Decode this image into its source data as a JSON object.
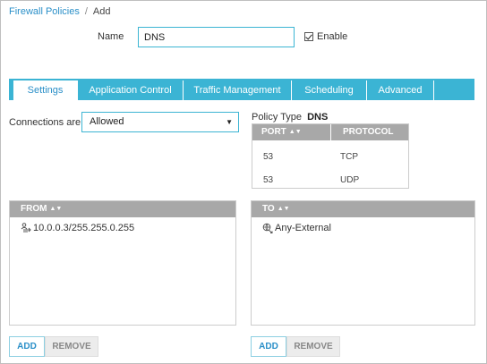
{
  "breadcrumb": {
    "parent": "Firewall Policies",
    "separator": "/",
    "current": "Add"
  },
  "form": {
    "name_label": "Name",
    "name_value": "DNS",
    "enable_label": "Enable",
    "enable_checked": true
  },
  "tabs": [
    {
      "label": "Settings",
      "active": true
    },
    {
      "label": "Application Control",
      "active": false
    },
    {
      "label": "Traffic Management",
      "active": false
    },
    {
      "label": "Scheduling",
      "active": false
    },
    {
      "label": "Advanced",
      "active": false
    }
  ],
  "connections": {
    "label": "Connections are",
    "selected": "Allowed"
  },
  "policy_type": {
    "label": "Policy Type",
    "value": "DNS"
  },
  "ports_table": {
    "columns": [
      "PORT",
      "PROTOCOL"
    ],
    "rows": [
      {
        "port": "53",
        "protocol": "TCP"
      },
      {
        "port": "53",
        "protocol": "UDP"
      }
    ]
  },
  "from_panel": {
    "header": "FROM",
    "items": [
      {
        "icon": "host-icon",
        "label": "10.0.0.3/255.255.0.255"
      }
    ],
    "add_label": "ADD",
    "remove_label": "REMOVE"
  },
  "to_panel": {
    "header": "TO",
    "items": [
      {
        "icon": "external-alias-icon",
        "label": "Any-External"
      }
    ],
    "add_label": "ADD",
    "remove_label": "REMOVE"
  },
  "colors": {
    "accent": "#3bb4d4",
    "link": "#2a8fc8",
    "table_header": "#a8a8a8"
  }
}
